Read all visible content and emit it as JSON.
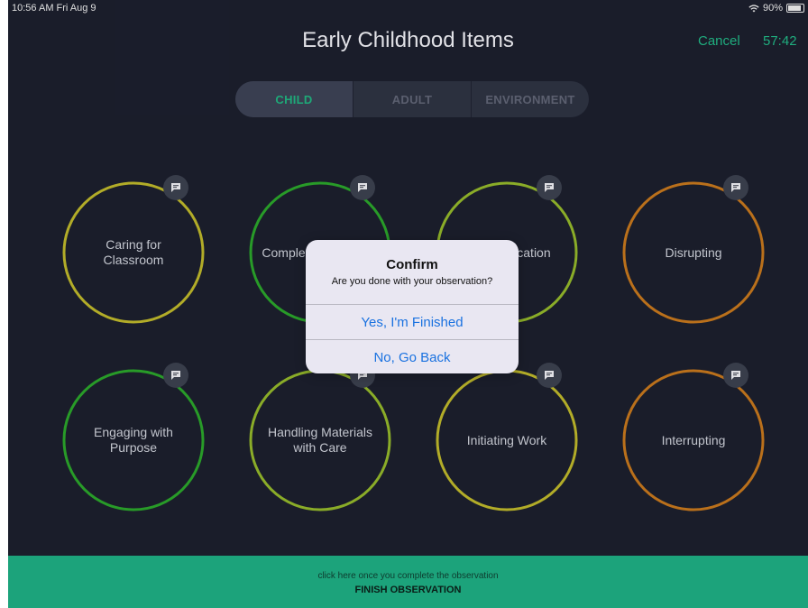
{
  "status": {
    "time": "10:56 AM  Fri Aug 9",
    "battery": "90%"
  },
  "header": {
    "title": "Early Childhood Items",
    "cancel": "Cancel",
    "timer": "57:42"
  },
  "tabs": [
    {
      "label": "CHILD",
      "active": true
    },
    {
      "label": "ADULT",
      "active": false
    },
    {
      "label": "ENVIRONMENT",
      "active": false
    }
  ],
  "items": [
    {
      "label": "Caring for Classroom",
      "color": "#b8b22a"
    },
    {
      "label": "Completing Activities",
      "color": "#2aa02a"
    },
    {
      "label": "Communication",
      "color": "#8fb22a"
    },
    {
      "label": "Disrupting",
      "color": "#c0741c"
    },
    {
      "label": "Engaging with Purpose",
      "color": "#2aa02a"
    },
    {
      "label": "Handling Materials with Care",
      "color": "#8fb22a"
    },
    {
      "label": "Initiating Work",
      "color": "#b8b22a"
    },
    {
      "label": "Interrupting",
      "color": "#c0741c"
    }
  ],
  "dialog": {
    "title": "Confirm",
    "message": "Are you done with your observation?",
    "confirm_label": "Yes, I'm Finished",
    "cancel_label": "No, Go Back"
  },
  "footer": {
    "hint": "click here once you complete the observation",
    "action": "FINISH OBSERVATION"
  },
  "colors": {
    "accent": "#21b383",
    "background": "#1b1e2c",
    "footer": "#1ca37b",
    "link": "#1a72e0"
  }
}
